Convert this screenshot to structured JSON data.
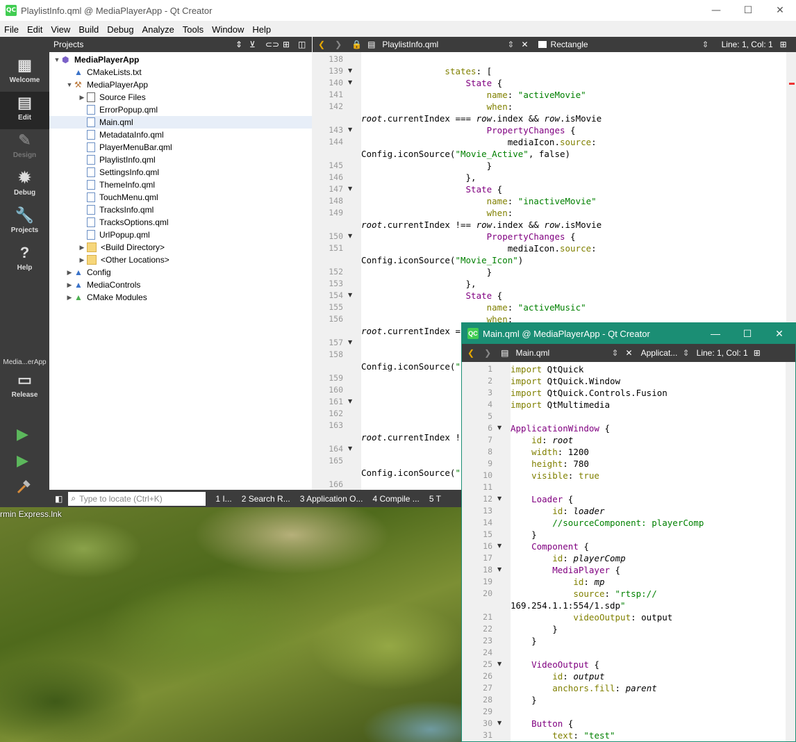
{
  "desktop": {
    "shortcut_label": "rmin Express.lnk"
  },
  "main_window": {
    "title": "PlaylistInfo.qml @ MediaPlayerApp - Qt Creator",
    "logo": "QC",
    "controls": {
      "minimize": "—",
      "maximize": "☐",
      "close": "✕"
    }
  },
  "menu": [
    "File",
    "Edit",
    "View",
    "Build",
    "Debug",
    "Analyze",
    "Tools",
    "Window",
    "Help"
  ],
  "modes": [
    {
      "label": "Welcome",
      "icon": "grid-icon"
    },
    {
      "label": "Edit",
      "icon": "document-icon"
    },
    {
      "label": "Design",
      "icon": "pencil-icon"
    },
    {
      "label": "Debug",
      "icon": "bug-icon"
    },
    {
      "label": "Projects",
      "icon": "wrench-icon"
    },
    {
      "label": "Help",
      "icon": "help-icon"
    }
  ],
  "kit": {
    "name": "Media...erApp",
    "config": "Release",
    "icon": "monitor-icon"
  },
  "run_controls": {
    "run": "▶",
    "debug_run": "▶",
    "build": "hammer"
  },
  "projects_panel": {
    "title": "Projects",
    "tree": [
      {
        "label": "MediaPlayerApp",
        "depth": 0,
        "arrow": "▼",
        "icon": "project",
        "bold": true
      },
      {
        "label": "CMakeLists.txt",
        "depth": 1,
        "arrow": "",
        "icon": "cmake"
      },
      {
        "label": "MediaPlayerApp",
        "depth": 1,
        "arrow": "▼",
        "icon": "hammer"
      },
      {
        "label": "Source Files",
        "depth": 2,
        "arrow": "▶",
        "icon": "sources"
      },
      {
        "label": "ErrorPopup.qml",
        "depth": 2,
        "arrow": "",
        "icon": "qml"
      },
      {
        "label": "Main.qml",
        "depth": 2,
        "arrow": "",
        "icon": "qml",
        "selected": true
      },
      {
        "label": "MetadataInfo.qml",
        "depth": 2,
        "arrow": "",
        "icon": "qml"
      },
      {
        "label": "PlayerMenuBar.qml",
        "depth": 2,
        "arrow": "",
        "icon": "qml"
      },
      {
        "label": "PlaylistInfo.qml",
        "depth": 2,
        "arrow": "",
        "icon": "qml"
      },
      {
        "label": "SettingsInfo.qml",
        "depth": 2,
        "arrow": "",
        "icon": "qml"
      },
      {
        "label": "ThemeInfo.qml",
        "depth": 2,
        "arrow": "",
        "icon": "qml"
      },
      {
        "label": "TouchMenu.qml",
        "depth": 2,
        "arrow": "",
        "icon": "qml"
      },
      {
        "label": "TracksInfo.qml",
        "depth": 2,
        "arrow": "",
        "icon": "qml"
      },
      {
        "label": "TracksOptions.qml",
        "depth": 2,
        "arrow": "",
        "icon": "qml"
      },
      {
        "label": "UrlPopup.qml",
        "depth": 2,
        "arrow": "",
        "icon": "qml"
      },
      {
        "label": "<Build Directory>",
        "depth": 2,
        "arrow": "▶",
        "icon": "folder"
      },
      {
        "label": "<Other Locations>",
        "depth": 2,
        "arrow": "▶",
        "icon": "folder"
      },
      {
        "label": "Config",
        "depth": 1,
        "arrow": "▶",
        "icon": "cmake"
      },
      {
        "label": "MediaControls",
        "depth": 1,
        "arrow": "▶",
        "icon": "cmake"
      },
      {
        "label": "CMake Modules",
        "depth": 1,
        "arrow": "▶",
        "icon": "cmake-modules"
      }
    ]
  },
  "editor": {
    "file": "PlaylistInfo.qml",
    "symbol": "Rectangle",
    "position": "Line: 1, Col: 1",
    "lines": [
      {
        "n": "138",
        "fold": false,
        "code": ""
      },
      {
        "n": "139",
        "fold": true,
        "code": "                states: ["
      },
      {
        "n": "140",
        "fold": true,
        "code": "                    State {"
      },
      {
        "n": "141",
        "fold": false,
        "code": "                        name: \"activeMovie\""
      },
      {
        "n": "142",
        "fold": false,
        "code": "                        when:"
      },
      {
        "n": "",
        "fold": false,
        "code": "root.currentIndex === row.index && row.isMovie"
      },
      {
        "n": "143",
        "fold": true,
        "code": "                        PropertyChanges {"
      },
      {
        "n": "144",
        "fold": false,
        "code": "                            mediaIcon.source:"
      },
      {
        "n": "",
        "fold": false,
        "code": "Config.iconSource(\"Movie_Active\", false)"
      },
      {
        "n": "145",
        "fold": false,
        "code": "                        }"
      },
      {
        "n": "146",
        "fold": false,
        "code": "                    },"
      },
      {
        "n": "147",
        "fold": true,
        "code": "                    State {"
      },
      {
        "n": "148",
        "fold": false,
        "code": "                        name: \"inactiveMovie\""
      },
      {
        "n": "149",
        "fold": false,
        "code": "                        when:"
      },
      {
        "n": "",
        "fold": false,
        "code": "root.currentIndex !== row.index && row.isMovie"
      },
      {
        "n": "150",
        "fold": true,
        "code": "                        PropertyChanges {"
      },
      {
        "n": "151",
        "fold": false,
        "code": "                            mediaIcon.source:"
      },
      {
        "n": "",
        "fold": false,
        "code": "Config.iconSource(\"Movie_Icon\")"
      },
      {
        "n": "152",
        "fold": false,
        "code": "                        }"
      },
      {
        "n": "153",
        "fold": false,
        "code": "                    },"
      },
      {
        "n": "154",
        "fold": true,
        "code": "                    State {"
      },
      {
        "n": "155",
        "fold": false,
        "code": "                        name: \"activeMusic\""
      },
      {
        "n": "156",
        "fold": false,
        "code": "                        when:"
      },
      {
        "n": "",
        "fold": false,
        "code": "root.currentIndex ="
      },
      {
        "n": "157",
        "fold": true,
        "code": ""
      },
      {
        "n": "158",
        "fold": false,
        "code": ""
      },
      {
        "n": "",
        "fold": false,
        "code": "Config.iconSource(\""
      },
      {
        "n": "159",
        "fold": false,
        "code": ""
      },
      {
        "n": "160",
        "fold": false,
        "code": ""
      },
      {
        "n": "161",
        "fold": true,
        "code": ""
      },
      {
        "n": "162",
        "fold": false,
        "code": ""
      },
      {
        "n": "163",
        "fold": false,
        "code": ""
      },
      {
        "n": "",
        "fold": false,
        "code": "root.currentIndex !"
      },
      {
        "n": "164",
        "fold": true,
        "code": ""
      },
      {
        "n": "165",
        "fold": false,
        "code": ""
      },
      {
        "n": "",
        "fold": false,
        "code": "Config.iconSource(\""
      },
      {
        "n": "166",
        "fold": false,
        "code": ""
      }
    ]
  },
  "bottom_bar": {
    "locate_placeholder": "Type to locate (Ctrl+K)",
    "panes": [
      "1  I...",
      "2  Search R...",
      "3  Application O...",
      "4  Compile ...",
      "5  T"
    ]
  },
  "second_window": {
    "title": "Main.qml @ MediaPlayerApp - Qt Creator",
    "logo": "QC",
    "file": "Main.qml",
    "symbol": "Applicat...",
    "position": "Line: 1, Col: 1",
    "lines": [
      {
        "n": "1",
        "fold": false,
        "code": "import QtQuick"
      },
      {
        "n": "2",
        "fold": false,
        "code": "import QtQuick.Window"
      },
      {
        "n": "3",
        "fold": false,
        "code": "import QtQuick.Controls.Fusion"
      },
      {
        "n": "4",
        "fold": false,
        "code": "import QtMultimedia"
      },
      {
        "n": "5",
        "fold": false,
        "code": ""
      },
      {
        "n": "6",
        "fold": true,
        "code": "ApplicationWindow {"
      },
      {
        "n": "7",
        "fold": false,
        "code": "    id: root"
      },
      {
        "n": "8",
        "fold": false,
        "code": "    width: 1200"
      },
      {
        "n": "9",
        "fold": false,
        "code": "    height: 780"
      },
      {
        "n": "10",
        "fold": false,
        "code": "    visible: true"
      },
      {
        "n": "11",
        "fold": false,
        "code": ""
      },
      {
        "n": "12",
        "fold": true,
        "code": "    Loader {"
      },
      {
        "n": "13",
        "fold": false,
        "code": "        id: loader"
      },
      {
        "n": "14",
        "fold": false,
        "code": "        //sourceComponent: playerComp"
      },
      {
        "n": "15",
        "fold": false,
        "code": "    }"
      },
      {
        "n": "16",
        "fold": true,
        "code": "    Component {"
      },
      {
        "n": "17",
        "fold": false,
        "code": "        id: playerComp"
      },
      {
        "n": "18",
        "fold": true,
        "code": "        MediaPlayer {"
      },
      {
        "n": "19",
        "fold": false,
        "code": "            id: mp"
      },
      {
        "n": "20",
        "fold": false,
        "code": "            source: \"rtsp://"
      },
      {
        "n": "",
        "fold": false,
        "code": "169.254.1.1:554/1.sdp\""
      },
      {
        "n": "21",
        "fold": false,
        "code": "            videoOutput: output"
      },
      {
        "n": "22",
        "fold": false,
        "code": "        }"
      },
      {
        "n": "23",
        "fold": false,
        "code": "    }"
      },
      {
        "n": "24",
        "fold": false,
        "code": ""
      },
      {
        "n": "25",
        "fold": true,
        "code": "    VideoOutput {"
      },
      {
        "n": "26",
        "fold": false,
        "code": "        id: output"
      },
      {
        "n": "27",
        "fold": false,
        "code": "        anchors.fill: parent"
      },
      {
        "n": "28",
        "fold": false,
        "code": "    }"
      },
      {
        "n": "29",
        "fold": false,
        "code": ""
      },
      {
        "n": "30",
        "fold": true,
        "code": "    Button {"
      },
      {
        "n": "31",
        "fold": false,
        "code": "        text: \"test\""
      }
    ]
  }
}
